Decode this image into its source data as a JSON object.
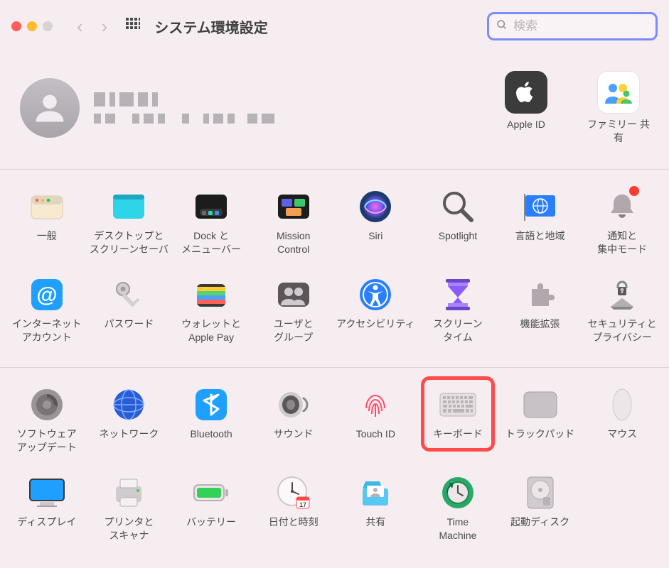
{
  "window": {
    "title": "システム環境設定"
  },
  "search": {
    "placeholder": "検索",
    "value": ""
  },
  "profile": {
    "side": {
      "apple_id": "Apple ID",
      "family": "ファミリー\n共有"
    }
  },
  "groups": [
    {
      "row1": [
        {
          "key": "general",
          "label": "一般"
        },
        {
          "key": "desktop",
          "label": "デスクトップと\nスクリーンセーバ"
        },
        {
          "key": "dock",
          "label": "Dock と\nメニューバー"
        },
        {
          "key": "mission",
          "label": "Mission\nControl"
        },
        {
          "key": "siri",
          "label": "Siri"
        },
        {
          "key": "spotlight",
          "label": "Spotlight"
        },
        {
          "key": "language",
          "label": "言語と地域"
        },
        {
          "key": "notifications",
          "label": "通知と\n集中モード"
        }
      ],
      "row2": [
        {
          "key": "internet",
          "label": "インターネット\nアカウント"
        },
        {
          "key": "passwords",
          "label": "パスワード"
        },
        {
          "key": "wallet",
          "label": "ウォレットと\nApple Pay"
        },
        {
          "key": "users",
          "label": "ユーザと\nグループ"
        },
        {
          "key": "accessibility",
          "label": "アクセシビリティ"
        },
        {
          "key": "screentime",
          "label": "スクリーン\nタイム"
        },
        {
          "key": "extensions",
          "label": "機能拡張"
        },
        {
          "key": "security",
          "label": "セキュリティと\nプライバシー"
        }
      ]
    },
    {
      "row1": [
        {
          "key": "software",
          "label": "ソフトウェア\nアップデート"
        },
        {
          "key": "network",
          "label": "ネットワーク"
        },
        {
          "key": "bluetooth",
          "label": "Bluetooth"
        },
        {
          "key": "sound",
          "label": "サウンド"
        },
        {
          "key": "touchid",
          "label": "Touch ID"
        },
        {
          "key": "keyboard",
          "label": "キーボード",
          "highlight": true
        },
        {
          "key": "trackpad",
          "label": "トラックパッド"
        },
        {
          "key": "mouse",
          "label": "マウス"
        }
      ],
      "row2": [
        {
          "key": "displays",
          "label": "ディスプレイ"
        },
        {
          "key": "printers",
          "label": "プリンタと\nスキャナ"
        },
        {
          "key": "battery",
          "label": "バッテリー"
        },
        {
          "key": "datetime",
          "label": "日付と時刻"
        },
        {
          "key": "sharing",
          "label": "共有"
        },
        {
          "key": "timemachine",
          "label": "Time\nMachine"
        },
        {
          "key": "startup",
          "label": "起動ディスク"
        }
      ]
    }
  ]
}
